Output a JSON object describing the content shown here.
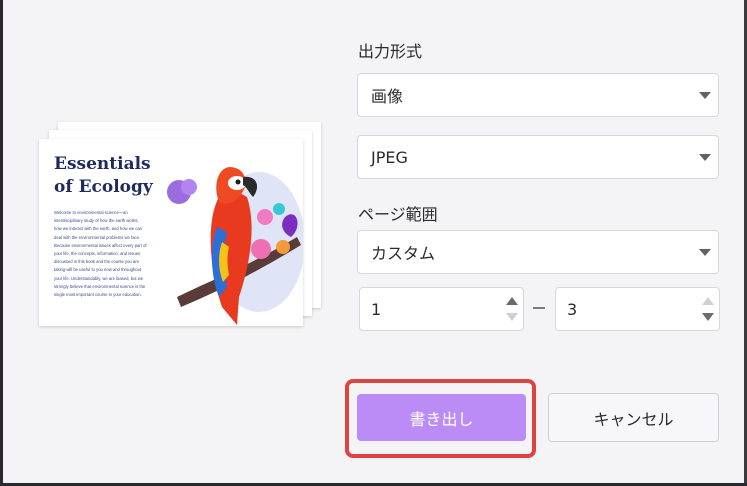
{
  "preview": {
    "title_lines": [
      "Essentials",
      "of Ecology"
    ],
    "body_lines": [
      "Welcome to environmental science—an",
      "interdisciplinary study of how the earth works,",
      "how we interact with the earth, and how we can",
      "deal with the environmental problems we face.",
      "Because environmental issues affect every part of",
      "your life, the concepts, information, and issues",
      "discussed in this book and the course you are",
      "taking will be useful to you now and throughout",
      "your life. Understandably, we are biased, but we",
      "strongly believe that environmental science is the",
      "single most important course in your education."
    ]
  },
  "form": {
    "output_format_label": "出力形式",
    "format_type": "画像",
    "image_format": "JPEG",
    "page_range_label": "ページ範囲",
    "page_range_mode": "カスタム",
    "page_from": "1",
    "page_to": "3"
  },
  "buttons": {
    "export": "書き出し",
    "cancel": "キャンセル"
  },
  "colors": {
    "export_button": "#bb8cf5",
    "highlight_border": "#e0433f",
    "doc_title": "#1f2a5e"
  }
}
